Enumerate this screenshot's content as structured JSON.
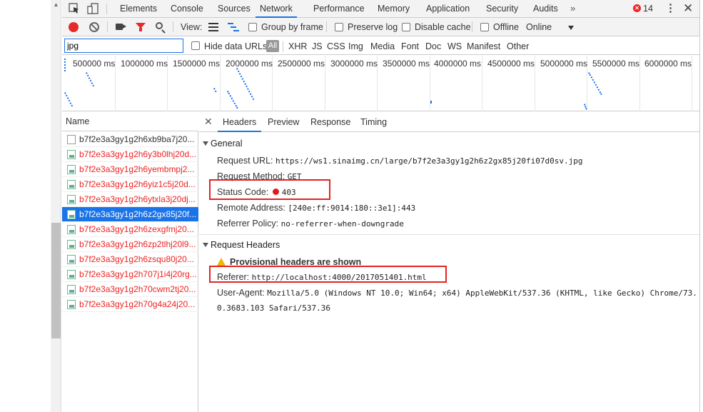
{
  "toolbar_tabs": [
    "Elements",
    "Console",
    "Sources",
    "Network",
    "Performance",
    "Memory",
    "Application",
    "Security",
    "Audits"
  ],
  "active_tab": "Network",
  "more_tabs_label": "»",
  "error_count": "14",
  "close_label": "✕",
  "kebab_label": "⋮",
  "network_toolbar": {
    "view_label": "View:",
    "group_by_frame": "Group by frame",
    "preserve_log": "Preserve log",
    "disable_cache": "Disable cache",
    "offline": "Offline",
    "throttle": "Online"
  },
  "filter": {
    "value": "jpg",
    "hide_data_urls": "Hide data URLs",
    "types": [
      "All",
      "XHR",
      "JS",
      "CSS",
      "Img",
      "Media",
      "Font",
      "Doc",
      "WS",
      "Manifest",
      "Other"
    ],
    "active_type": "All"
  },
  "timeline_labels": [
    "500000 ms",
    "1000000 ms",
    "1500000 ms",
    "2000000 ms",
    "2500000 ms",
    "3000000 ms",
    "3500000 ms",
    "4000000 ms",
    "4500000 ms",
    "5000000 ms",
    "5500000 ms",
    "6000000 ms"
  ],
  "name_column": {
    "header": "Name",
    "requests": [
      {
        "name": "b7f2e3a3gy1g2h6xb9ba7j20...",
        "status": "normal"
      },
      {
        "name": "b7f2e3a3gy1g2h6y3b0lhj20d...",
        "status": "error"
      },
      {
        "name": "b7f2e3a3gy1g2h6yembmpj2...",
        "status": "error"
      },
      {
        "name": "b7f2e3a3gy1g2h6yiz1c5j20d...",
        "status": "error"
      },
      {
        "name": "b7f2e3a3gy1g2h6ytxla3j20dj...",
        "status": "error"
      },
      {
        "name": "b7f2e3a3gy1g2h6z2gx85j20f...",
        "status": "selected"
      },
      {
        "name": "b7f2e3a3gy1g2h6zexgfmj20...",
        "status": "error"
      },
      {
        "name": "b7f2e3a3gy1g2h6zp2tlhj20l9...",
        "status": "error"
      },
      {
        "name": "b7f2e3a3gy1g2h6zsqu80j20...",
        "status": "error"
      },
      {
        "name": "b7f2e3a3gy1g2h707j1i4j20rg...",
        "status": "error"
      },
      {
        "name": "b7f2e3a3gy1g2h70cwm2tj20...",
        "status": "error"
      },
      {
        "name": "b7f2e3a3gy1g2h70g4a24j20...",
        "status": "error"
      }
    ]
  },
  "detail_tabs": [
    "Headers",
    "Preview",
    "Response",
    "Timing"
  ],
  "active_detail_tab": "Headers",
  "general": {
    "title": "General",
    "request_url_label": "Request URL:",
    "request_url": "https://ws1.sinaimg.cn/large/b7f2e3a3gy1g2h6z2gx85j20fi07d0sv.jpg",
    "request_method_label": "Request Method:",
    "request_method": "GET",
    "status_code_label": "Status Code:",
    "status_code": "403",
    "remote_address_label": "Remote Address:",
    "remote_address": "[240e:ff:9014:180::3e1]:443",
    "referrer_policy_label": "Referrer Policy:",
    "referrer_policy": "no-referrer-when-downgrade"
  },
  "request_headers": {
    "title": "Request Headers",
    "provisional_warning": "Provisional headers are shown",
    "referer_label": "Referer:",
    "referer": "http://localhost:4000/2017051401.html",
    "user_agent_label": "User-Agent:",
    "user_agent_line1": "Mozilla/5.0 (Windows NT 10.0; Win64; x64) AppleWebKit/537.36 (KHTML, like Gecko) Chrome/73.",
    "user_agent_line2": "0.3683.103 Safari/537.36"
  },
  "colors": {
    "accent": "#1a73e8",
    "error": "#e22222",
    "highlight_box": "#e52222"
  }
}
